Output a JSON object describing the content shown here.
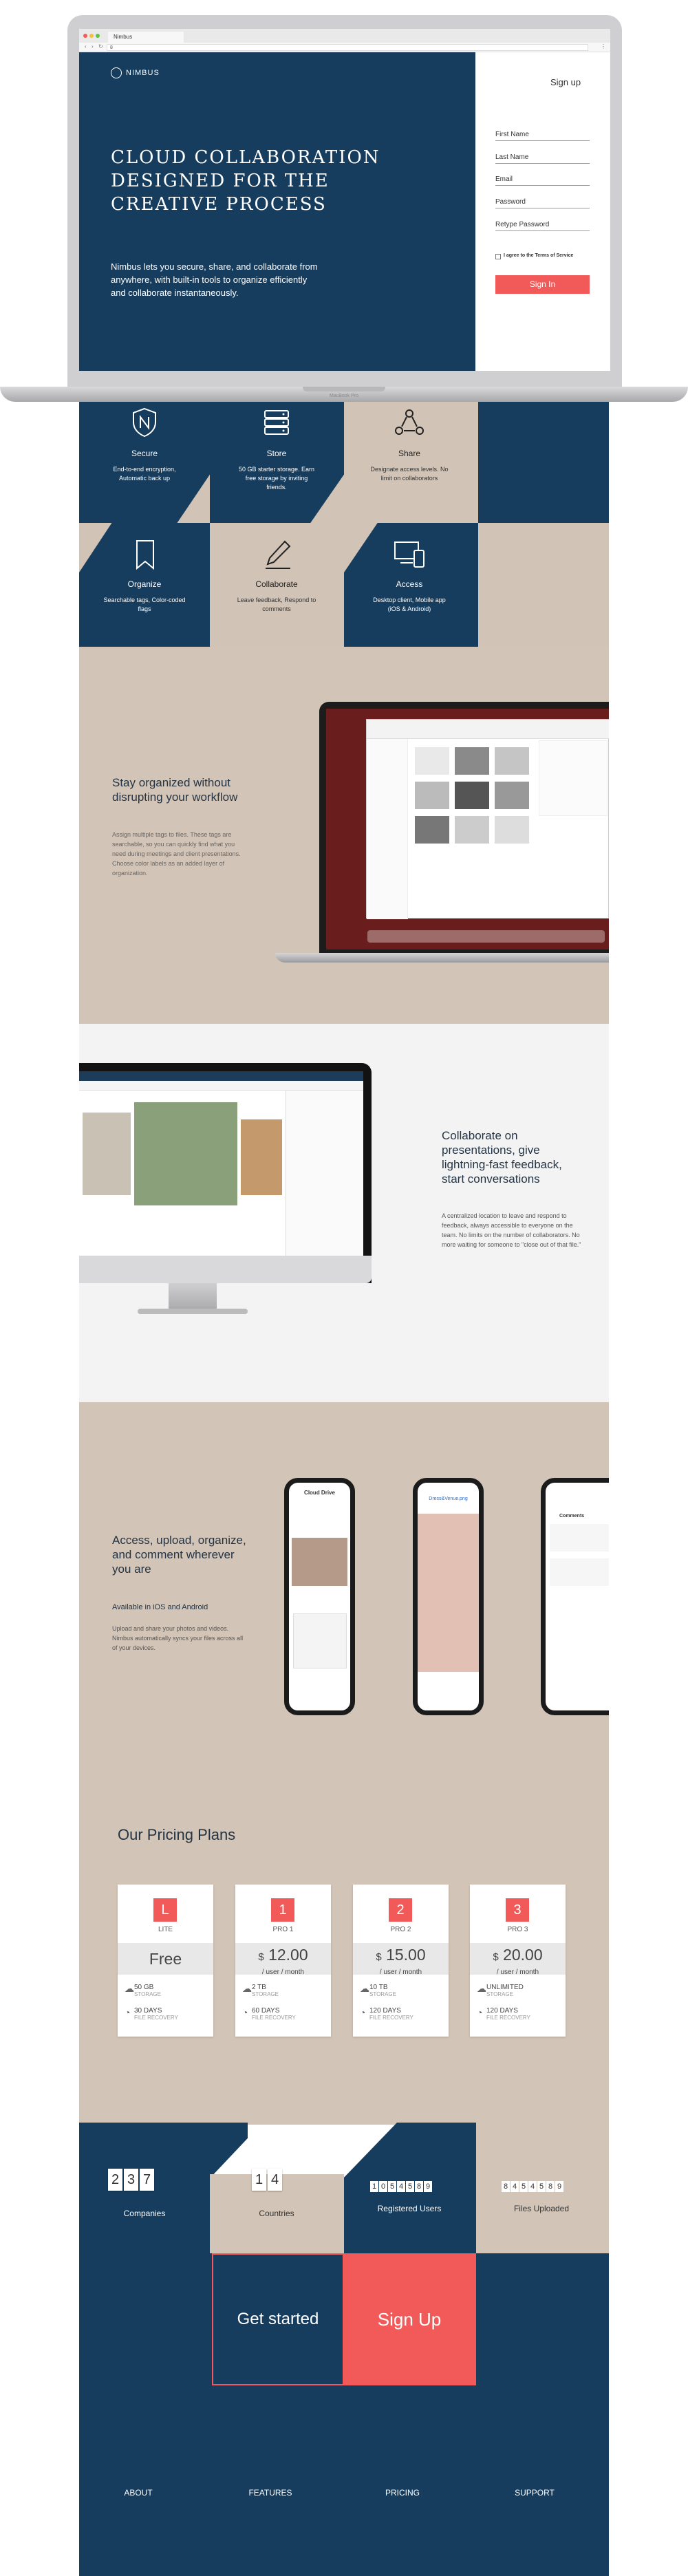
{
  "browser": {
    "tab_title": "Nimbus",
    "url": "8"
  },
  "laptop_label": "MacBook Pro",
  "hero": {
    "brand": "NIMBUS",
    "signup_link": "Sign up",
    "headline": "Cloud collaboration designed for the creative process",
    "description": "Nimbus lets you secure, share, and collaborate from anywhere, with built-in tools to organize efficiently and collaborate instantaneously.",
    "form": {
      "first_name": "First Name",
      "last_name": "Last Name",
      "email": "Email",
      "password": "Password",
      "retype_password": "Retype Password",
      "terms": "I agree to the Terms of Service",
      "submit": "Sign In"
    }
  },
  "features": [
    {
      "title": "Secure",
      "desc": "End-to-end encryption, Automatic back up",
      "icon": "shield-icon"
    },
    {
      "title": "Store",
      "desc": "50 GB starter storage. Earn free storage by inviting friends.",
      "icon": "server-icon"
    },
    {
      "title": "Share",
      "desc": "Designate access levels. No limit on collaborators",
      "icon": "share-icon"
    },
    {
      "title": "Organize",
      "desc": "Searchable tags, Color-coded flags",
      "icon": "bookmark-icon"
    },
    {
      "title": "Collaborate",
      "desc": "Leave feedback, Respond to comments",
      "icon": "pencil-icon"
    },
    {
      "title": "Access",
      "desc": "Desktop client, Mobile app (iOS & Android)",
      "icon": "devices-icon"
    }
  ],
  "section_organize": {
    "title": "Stay organized without disrupting your workflow",
    "body": "Assign multiple tags to files. These tags are searchable, so you can quickly find what you need during meetings and client presentations. Choose color labels as an added layer of organization."
  },
  "section_collaborate": {
    "title": "Collaborate on presentations, give lightning-fast feedback, start conversations",
    "body": "A centralized location to leave and respond to feedback, always accessible to everyone on the team. No limits on the number of collaborators. No more waiting for someone to \"close out of that file.\""
  },
  "section_mobile": {
    "title": "Access, upload, organize, and comment wherever you are",
    "subtitle": "Available in iOS and Android",
    "body": "Upload and share your photos and videos. Nimbus automatically syncs your files across all of your devices.",
    "phone1_title": "Cloud Drive",
    "phone2_title": "Dress&Venue.png",
    "phone3_title": "Comments"
  },
  "pricing": {
    "title": "Our Pricing Plans",
    "plans": [
      {
        "badge": "L",
        "name": "LITE",
        "currency": "",
        "price": "Free",
        "unit": "",
        "storage": "50 GB",
        "storage_label": "STORAGE",
        "recovery": "30 DAYS",
        "recovery_label": "FILE RECOVERY"
      },
      {
        "badge": "1",
        "name": "PRO 1",
        "currency": "$",
        "price": "12.00",
        "unit": "/ user / month",
        "storage": "2 TB",
        "storage_label": "STORAGE",
        "recovery": "60 DAYS",
        "recovery_label": "FILE RECOVERY"
      },
      {
        "badge": "2",
        "name": "PRO 2",
        "currency": "$",
        "price": "15.00",
        "unit": "/ user / month",
        "storage": "10 TB",
        "storage_label": "STORAGE",
        "recovery": "120 DAYS",
        "recovery_label": "FILE RECOVERY"
      },
      {
        "badge": "3",
        "name": "PRO 3",
        "currency": "$",
        "price": "20.00",
        "unit": "/ user / month",
        "storage": "UNLIMITED",
        "storage_label": "STORAGE",
        "recovery": "120 DAYS",
        "recovery_label": "FILE RECOVERY"
      }
    ]
  },
  "stats": {
    "companies_digits": [
      "2",
      "3",
      "7"
    ],
    "companies_label": "Companies",
    "countries_digits": [
      "1",
      "4"
    ],
    "countries_label": "Countries",
    "users_digits": [
      "1",
      "0",
      "5",
      "4",
      "5",
      "8",
      "9"
    ],
    "users_label": "Registered Users",
    "files_digits": [
      "8",
      "4",
      "5",
      "4",
      "5",
      "8",
      "9"
    ],
    "files_label": "Files Uploaded"
  },
  "cta": {
    "get_started": "Get started",
    "sign_up": "Sign Up"
  },
  "footer": {
    "links": [
      "ABOUT",
      "FEATURES",
      "PRICING",
      "SUPPORT"
    ]
  },
  "colors": {
    "navy": "#173d5e",
    "tan": "#d1c3b5",
    "accent": "#f25a5a"
  }
}
